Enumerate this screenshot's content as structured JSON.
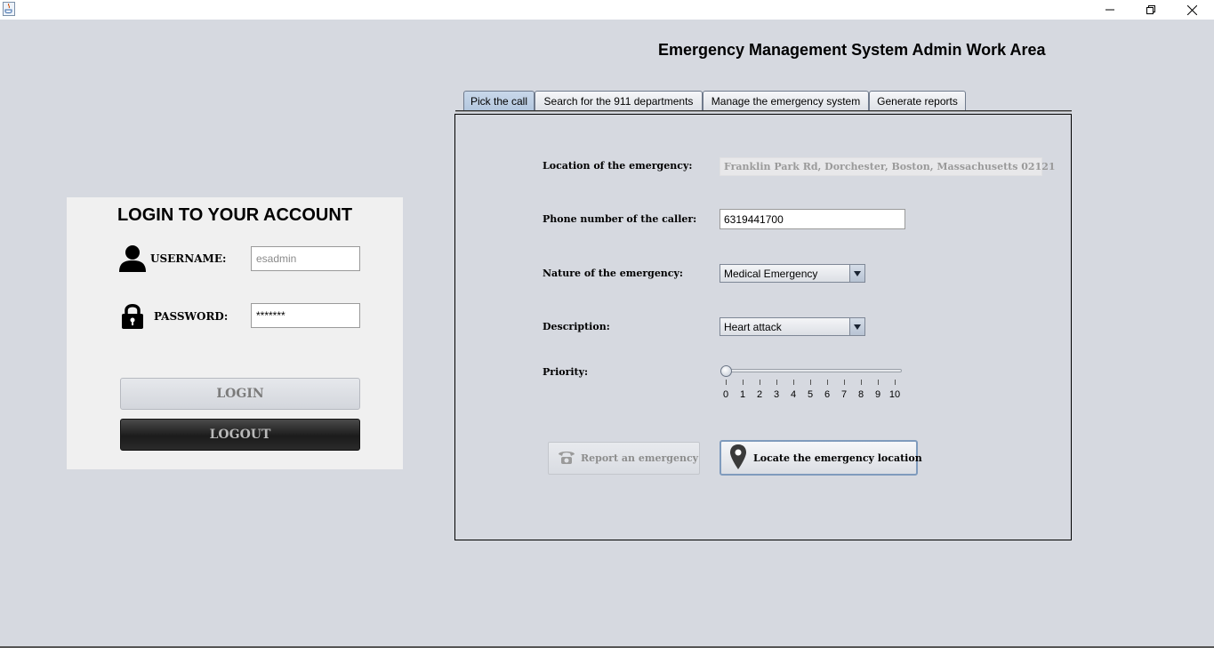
{
  "window": {
    "app_icon": "java-cup-icon",
    "controls": [
      "minimize-icon",
      "restore-icon",
      "close-icon"
    ]
  },
  "header": {
    "title": "Emergency Management System Admin Work Area"
  },
  "login": {
    "title": "LOGIN TO YOUR ACCOUNT",
    "username_label": "USERNAME:",
    "username_value": "esadmin",
    "password_label": "PASSWORD:",
    "password_value": "*******",
    "login_button": "LOGIN",
    "logout_button": "LOGOUT",
    "icons": [
      "user-icon",
      "lock-icon"
    ]
  },
  "tabs": [
    {
      "label": "Pick the call",
      "active": true
    },
    {
      "label": "Search for the 911 departments",
      "active": false
    },
    {
      "label": "Manage the emergency system",
      "active": false
    },
    {
      "label": "Generate reports",
      "active": false
    }
  ],
  "form": {
    "location_label": "Location of the emergency:",
    "location_value": "Franklin Park Rd, Dorchester, Boston, Massachusetts 02121",
    "phone_label": "Phone number of the caller:",
    "phone_value": "6319441700",
    "nature_label": "Nature of the emergency:",
    "nature_value": "Medical Emergency",
    "description_label": "Description:",
    "description_value": "Heart attack",
    "priority_label": "Priority:",
    "priority": {
      "value": 0,
      "min": 0,
      "max": 10,
      "ticks": [
        "0",
        "1",
        "2",
        "3",
        "4",
        "5",
        "6",
        "7",
        "8",
        "9",
        "10"
      ]
    }
  },
  "actions": {
    "report_button": "Report an emergency",
    "locate_button": "Locate the emergency location"
  },
  "colors": {
    "background": "#d6d9e0",
    "panel": "#f0f0f0",
    "active_tab": "#b2c6de",
    "logout_bg": "#1b1b1b"
  }
}
